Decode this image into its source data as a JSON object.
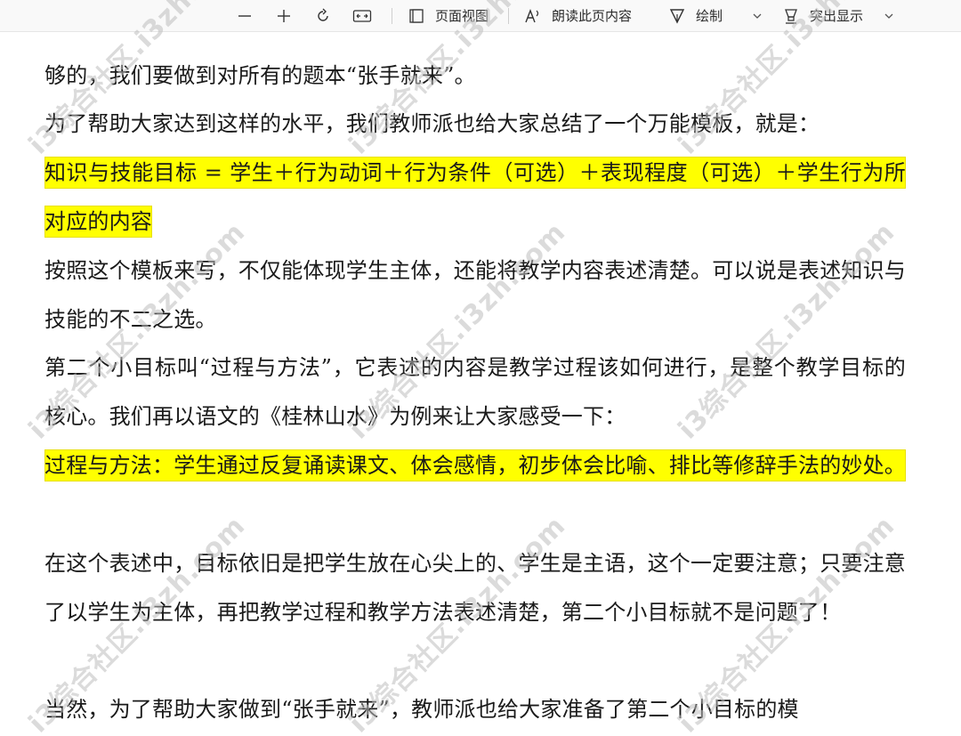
{
  "toolbar": {
    "zoom_out_label": "—",
    "zoom_in_label": "+",
    "page_view_label": "页面视图",
    "read_aloud_label": "朗读此页内容",
    "draw_label": "绘制",
    "highlight_label": "突出显示",
    "icons": [
      "minus-icon",
      "plus-icon",
      "rotate-icon",
      "fit-width-icon",
      "page-view-icon",
      "read-aloud-icon",
      "draw-icon",
      "chevron-down-icon",
      "highlight-icon",
      "chevron-down-icon"
    ]
  },
  "document": {
    "paragraphs": [
      {
        "text": "够的，我们要做到对所有的题本“张手就来”。",
        "highlighted": false
      },
      {
        "text": "为了帮助大家达到这样的水平，我们教师派也给大家总结了一个万能模板，就是：",
        "highlighted": false
      },
      {
        "text": "知识与技能目标 = 学生＋行为动词＋行为条件（可选）＋表现程度（可选）＋学生行为所对应的内容",
        "highlighted": true
      },
      {
        "text": "按照这个模板来写，不仅能体现学生主体，还能将教学内容表述清楚。可以说是表述知识与技能的不二之选。",
        "highlighted": false
      },
      {
        "text": "第二个小目标叫“过程与方法”，它表述的内容是教学过程该如何进行，是整个教学目标的核心。我们再以语文的《桂林山水》为例来让大家感受一下：",
        "highlighted": false
      },
      {
        "text": "过程与方法：学生通过反复诵读课文、体会感情，初步体会比喻、排比等修辞手法的妙处。",
        "highlighted": true
      },
      {
        "text": "在这个表述中，目标依旧是把学生放在心尖上的、学生是主语，这个一定要注意；只要注意了以学生为主体，再把教学过程和教学方法表述清楚，第二个小目标就不是问题了！",
        "highlighted": false
      },
      {
        "text": "当然，为了帮助大家做到“张手就来”，教师派也给大家准备了第二个小目标的模",
        "highlighted": false
      }
    ]
  },
  "watermark": {
    "text": "i3综合社区.i3zh.com"
  },
  "colors": {
    "highlight": "#ffff00",
    "toolbar_bg": "#f9f9f9"
  }
}
